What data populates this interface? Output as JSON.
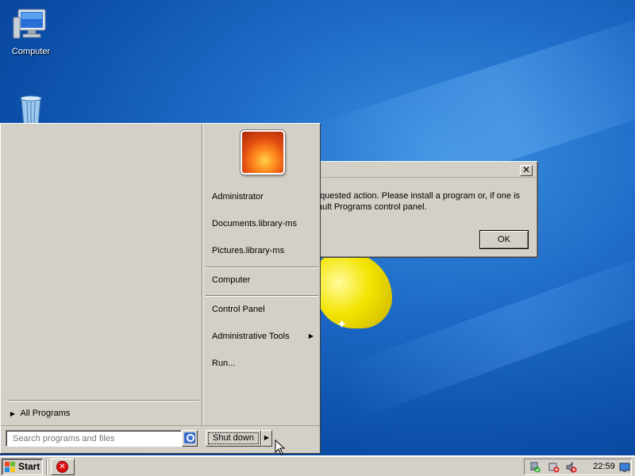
{
  "desktop": {
    "icons": [
      {
        "label": "Computer",
        "icon": "computer-icon"
      },
      {
        "label": "",
        "icon": "recycle-bin-icon"
      }
    ]
  },
  "dialog": {
    "close_label": "✕",
    "message": "equested action. Please install a program or, if one is\nfault Programs control panel.",
    "ok_label": "OK"
  },
  "start_menu": {
    "user_picture": "user-picture-flower",
    "all_programs_label": "All Programs",
    "right_items": [
      {
        "label": "Administrator"
      },
      {
        "label": "Documents.library-ms"
      },
      {
        "label": "Pictures.library-ms"
      },
      {
        "label": "Computer"
      },
      {
        "label": "Control Panel"
      },
      {
        "label": "Administrative Tools",
        "has_submenu": true
      },
      {
        "label": "Run..."
      }
    ],
    "search_placeholder": "Search programs and files",
    "shutdown_label": "Shut down"
  },
  "taskbar": {
    "start_label": "Start",
    "tasks": [
      {
        "icon": "error-icon"
      }
    ],
    "tray_icons": [
      "network-icon",
      "security-alert-icon",
      "volume-muted-icon"
    ],
    "clock": "22:59",
    "corner_icon": "show-desktop-icon"
  },
  "colors": {
    "desktop_blue": "#1e6cc8",
    "classic_gray": "#d4d0c8",
    "error_red": "#dd1111"
  }
}
